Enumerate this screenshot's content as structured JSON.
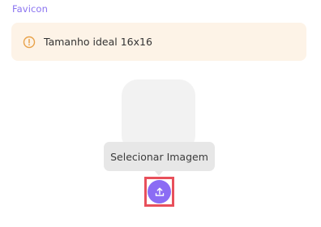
{
  "favicon_section": {
    "title": "Favicon",
    "info": {
      "icon": "warning-circle-icon",
      "text": "Tamanho ideal 16x16"
    },
    "preview": {},
    "tooltip": {
      "text": "Selecionar Imagem"
    },
    "upload_button": {
      "icon": "upload-icon"
    }
  },
  "colors": {
    "accent": "#8b6cf4",
    "title": "#8a73f0",
    "info_bg": "#fdf3e7",
    "info_icon": "#e8a24a",
    "highlight": "#e8505b",
    "tooltip_bg": "#e7e7e7",
    "preview_bg": "#f2f2f2"
  }
}
